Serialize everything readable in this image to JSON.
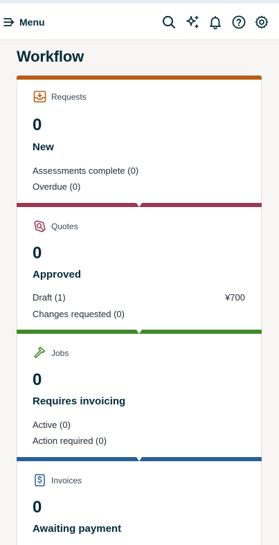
{
  "topbar": {
    "menu_label": "Menu",
    "icons": [
      "search-icon",
      "sparkles-icon",
      "bell-icon",
      "help-icon",
      "gear-icon"
    ]
  },
  "page": {
    "title": "Workflow"
  },
  "colors": {
    "requests": "#b85d14",
    "quotes": "#9a3a50",
    "jobs": "#3f8a26",
    "invoices": "#2c5f9a"
  },
  "cards": {
    "requests": {
      "label": "Requests",
      "count": "0",
      "status": "New",
      "lines": [
        "Assessments complete (0)",
        "Overdue (0)"
      ]
    },
    "quotes": {
      "label": "Quotes",
      "count": "0",
      "status": "Approved",
      "lines": [
        "Draft (1)",
        "Changes requested (0)"
      ],
      "draft_amount": "¥700"
    },
    "jobs": {
      "label": "Jobs",
      "count": "0",
      "status": "Requires invoicing",
      "lines": [
        "Active (0)",
        "Action required (0)"
      ]
    },
    "invoices": {
      "label": "Invoices",
      "count": "0",
      "status": "Awaiting payment"
    }
  }
}
